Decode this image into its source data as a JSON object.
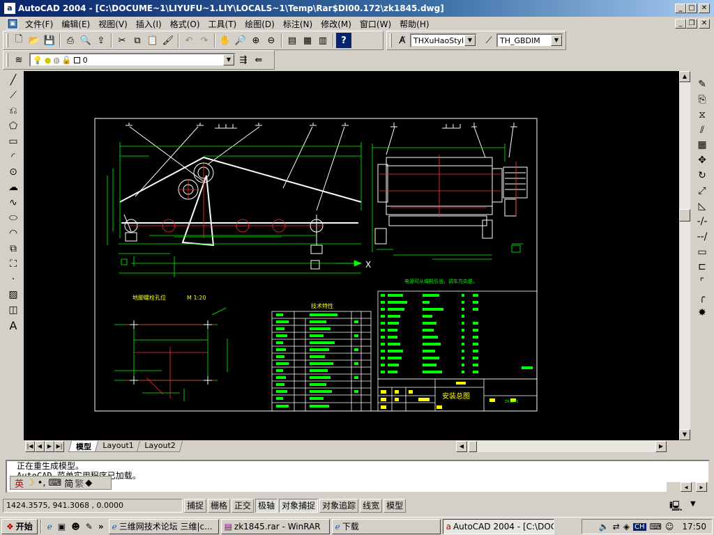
{
  "title": "AutoCAD 2004 - [C:\\DOCUME~1\\LIYUFU~1.LIY\\LOCALS~1\\Temp\\Rar$DI00.172\\zk1845.dwg]",
  "menu": [
    "文件(F)",
    "编辑(E)",
    "视图(V)",
    "插入(I)",
    "格式(O)",
    "工具(T)",
    "绘图(D)",
    "标注(N)",
    "修改(M)",
    "窗口(W)",
    "帮助(H)"
  ],
  "toolbar": {
    "text_style": "THXuHaoStyle",
    "dim_style": "TH_GBDIM",
    "layer": "0"
  },
  "layout_tabs": [
    "模型",
    "Layout1",
    "Layout2"
  ],
  "command_lines": [
    "正在重生成模型。",
    "AutoCAD 菜单实用程序已加载。"
  ],
  "ime": {
    "lang": "英",
    "mode": "简",
    "traditional": "繁"
  },
  "status": {
    "coords": "1424.3575,   941.3068  ,  0.0000",
    "buttons": [
      "捕捉",
      "栅格",
      "正交",
      "极轴",
      "对象捕捉",
      "对象追踪",
      "线宽",
      "模型"
    ],
    "active": [
      "极轴",
      "对象捕捉"
    ]
  },
  "taskbar": {
    "start": "开始",
    "tasks": [
      "三维网技术论坛 三维|c...",
      "zk1845.rar - WinRAR",
      "下载",
      "AutoCAD 2004 - [C:\\DOC..."
    ],
    "time": "17:50",
    "tray_ch": "CH"
  },
  "drawing": {
    "scale_label": "M 1:20",
    "table_title": "技术特性",
    "title_block": "安装总图",
    "axis_label": "X",
    "note": "电源可从绳机引出，调车方向是。",
    "foundation_label": "地脚螺栓孔位",
    "code": "ZK1845",
    "colors": {
      "bg": "#000000",
      "green": "#00ff00",
      "yellow": "#ffff00",
      "white": "#ffffff",
      "red": "#ff3030"
    }
  }
}
